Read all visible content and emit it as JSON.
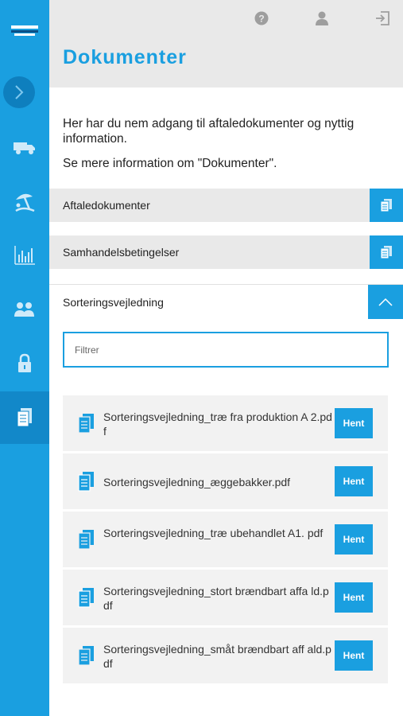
{
  "sidebar": {
    "items": [
      {
        "name": "truck-icon"
      },
      {
        "name": "beach-umbrella-icon"
      },
      {
        "name": "bar-chart-icon"
      },
      {
        "name": "users-icon"
      },
      {
        "name": "lock-icon"
      },
      {
        "name": "documents-icon",
        "active": true
      }
    ]
  },
  "header": {
    "title": "Dokumenter",
    "icons": [
      "help-icon",
      "user-icon",
      "logout-icon"
    ]
  },
  "intro": {
    "line1": "Her har du nem adgang til aftaledokumenter og nyttig information.",
    "line2": "Se mere information om \"Dokumenter\"."
  },
  "accordion": {
    "section1": "Aftaledokumenter",
    "section2": "Samhandelsbetingelser",
    "section3": "Sorteringsvejledning"
  },
  "filter": {
    "placeholder": "Filtrer"
  },
  "documents": [
    {
      "name": "Sorteringsvejledning_træ fra produktion A 2.pdf",
      "button": "Hent"
    },
    {
      "name": "Sorteringsvejledning_æggebakker.pdf",
      "button": "Hent"
    },
    {
      "name": "Sorteringsvejledning_træ ubehandlet A1. pdf",
      "button": "Hent"
    },
    {
      "name": "Sorteringsvejledning_stort brændbart affa ld.pdf",
      "button": "Hent"
    },
    {
      "name": "Sorteringsvejledning_småt brændbart aff ald.pdf",
      "button": "Hent"
    }
  ],
  "colors": {
    "accent": "#1a9fe0",
    "sidebar_active": "#1288c9",
    "header_bg": "#e9e9e9"
  }
}
